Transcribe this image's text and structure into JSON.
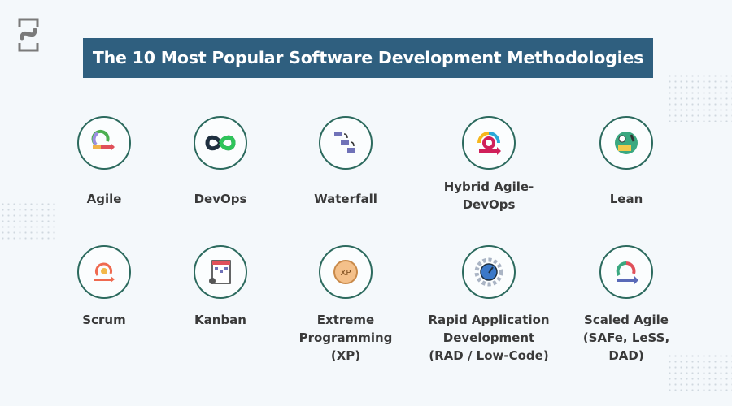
{
  "title": "The 10 Most Popular Software Development Methodologies",
  "colors": {
    "title_bg": "#2f5f7f",
    "circle_border": "#2c6a5e",
    "text": "#3a3a3a",
    "background": "#f4f8fb"
  },
  "methodologies": [
    {
      "label": "Agile",
      "icon": "agile-cycle-icon"
    },
    {
      "label": "DevOps",
      "icon": "devops-infinity-icon"
    },
    {
      "label": "Waterfall",
      "icon": "waterfall-steps-icon"
    },
    {
      "label": "Hybrid Agile-DevOps",
      "icon": "hybrid-gear-cycle-icon"
    },
    {
      "label": "Lean",
      "icon": "lean-process-icon"
    },
    {
      "label": "Scrum",
      "icon": "scrum-cycle-icon"
    },
    {
      "label": "Kanban",
      "icon": "kanban-board-icon"
    },
    {
      "label": "Extreme Programming (XP)",
      "icon": "xp-badge-icon"
    },
    {
      "label": "Rapid Application Development (RAD / Low-Code)",
      "icon": "speed-gear-icon"
    },
    {
      "label": "Scaled Agile (SAFe, LeSS, DAD)",
      "icon": "scaled-agile-cycle-icon"
    }
  ]
}
